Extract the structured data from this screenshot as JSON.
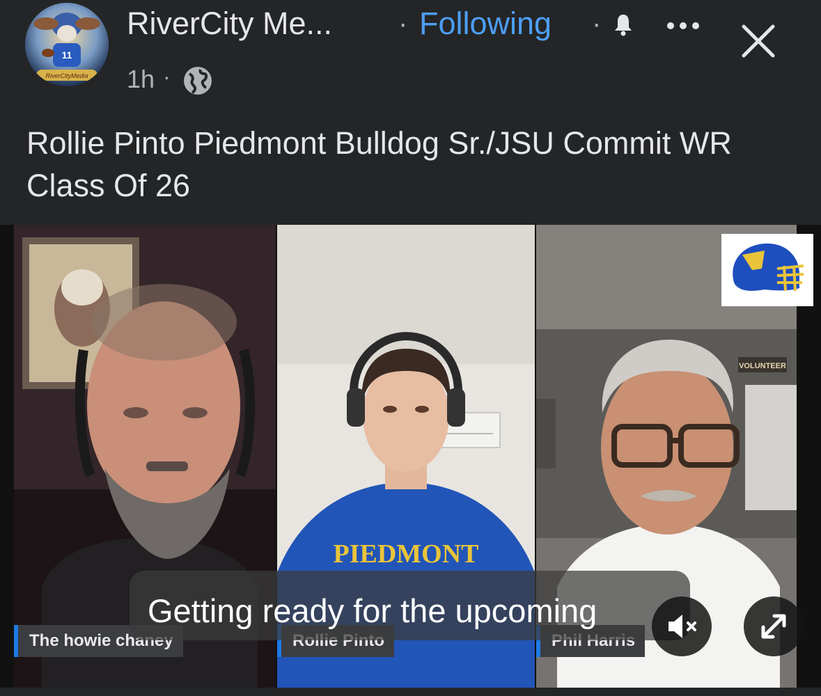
{
  "header": {
    "page_name": "RiverCity Me...",
    "separator": "·",
    "following_label": "Following",
    "separator2": "·",
    "timestamp": "1h",
    "separator3": "·",
    "icons": [
      "bell-icon",
      "more-icon",
      "close-icon",
      "globe-icon"
    ],
    "avatar_text": "RiverCityMedia"
  },
  "post": {
    "text": "Rollie Pinto Piedmont Bulldog Sr./JSU Commit WR Class Of 26"
  },
  "video": {
    "participants": [
      {
        "name": "The howie chaney"
      },
      {
        "name": "Rollie Pinto"
      },
      {
        "name": "Phil Harris"
      }
    ],
    "shirt_text": "PIEDMONT",
    "sign_text": "VOLUNTEER",
    "subtitle": "Getting ready for the upcoming",
    "controls": [
      "mute-icon",
      "expand-icon"
    ]
  },
  "colors": {
    "background": "#242526",
    "accent": "#4d9ef5",
    "nameplate_bar": "#1e7ae6"
  }
}
